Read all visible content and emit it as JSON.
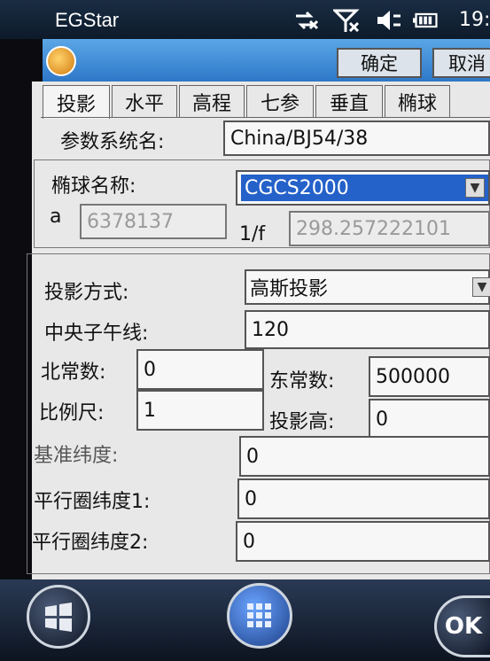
{
  "statusbar": {
    "app_title": "EGStar",
    "time": "19:",
    "icons": [
      "network-sync-icon",
      "no-signal-icon",
      "volume-muted-icon",
      "battery-icon"
    ]
  },
  "toolbar": {
    "ok_label": "确定",
    "cancel_label": "取消"
  },
  "tabs": [
    "投影",
    "水平",
    "高程",
    "七参",
    "垂直",
    "椭球"
  ],
  "params": {
    "system_name_label": "参数系统名:",
    "system_name_value": "China/BJ54/38",
    "ellipsoid_label": "椭球名称:",
    "ellipsoid_value": "CGCS2000",
    "a_label": "a",
    "a_value": "6378137",
    "f_label": "1/f",
    "f_value": "298.257222101"
  },
  "projection": {
    "method_label": "投影方式:",
    "method_value": "高斯投影",
    "central_meridian_label": "中央子午线:",
    "central_meridian_value": "120",
    "north_label": "北常数:",
    "north_value": "0",
    "east_label": "东常数:",
    "east_value": "500000",
    "scale_label": "比例尺:",
    "scale_value": "1",
    "height_label": "投影高:",
    "height_value": "0",
    "base_lat_label": "基准纬度:",
    "base_lat_value": "0",
    "parallel1_label": "平行圈纬度1:",
    "parallel1_value": "0",
    "parallel2_label": "平行圈纬度2:",
    "parallel2_value": "0"
  },
  "taskbar": {
    "ok_text": "OK"
  }
}
